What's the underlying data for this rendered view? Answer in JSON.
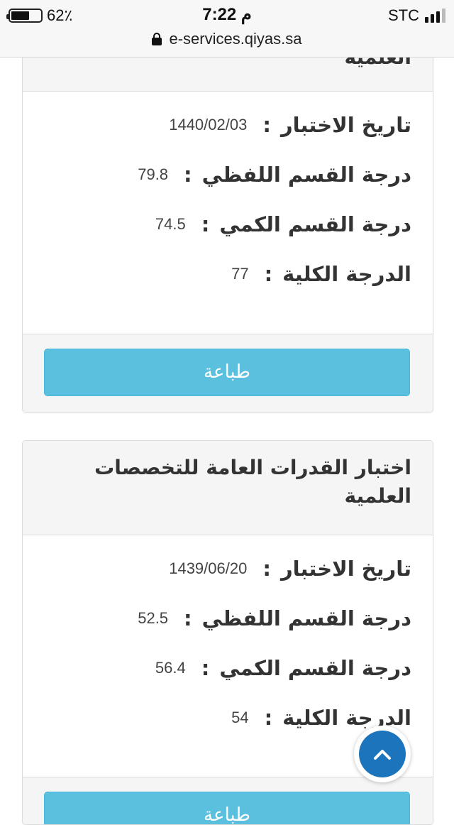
{
  "status_bar": {
    "battery_percent": "62٪",
    "battery_level": 0.62,
    "time": "7:22 م",
    "carrier": "STC",
    "url": "e-services.qiyas.sa"
  },
  "panel1": {
    "title": "العلمية",
    "rows": [
      {
        "label": "تاريخ الاختبار",
        "value": "1440/02/03"
      },
      {
        "label": "درجة القسم اللفظي",
        "value": "79.8"
      },
      {
        "label": "درجة القسم الكمي",
        "value": "74.5"
      },
      {
        "label": "الدرجة الكلية",
        "value": "77"
      }
    ],
    "colon": ":",
    "print_label": "طباعة"
  },
  "panel2": {
    "title": "اختبار القدرات العامة للتخصصات العلمية",
    "rows": [
      {
        "label": "تاريخ الاختبار",
        "value": "1439/06/20"
      },
      {
        "label": "درجة القسم اللفظي",
        "value": "52.5"
      },
      {
        "label": "درجة القسم الكمي",
        "value": "56.4"
      },
      {
        "label": "الدرجة الكلية",
        "value": "54"
      }
    ],
    "colon": ":",
    "print_label": "طباعة"
  },
  "icons": {
    "scroll_top": "chevron-up-icon",
    "lock": "lock-icon",
    "battery": "battery-icon",
    "signal": "signal-icon"
  },
  "colors": {
    "print_button": "#5bc0de",
    "scroll_top": "#1c75bc"
  }
}
